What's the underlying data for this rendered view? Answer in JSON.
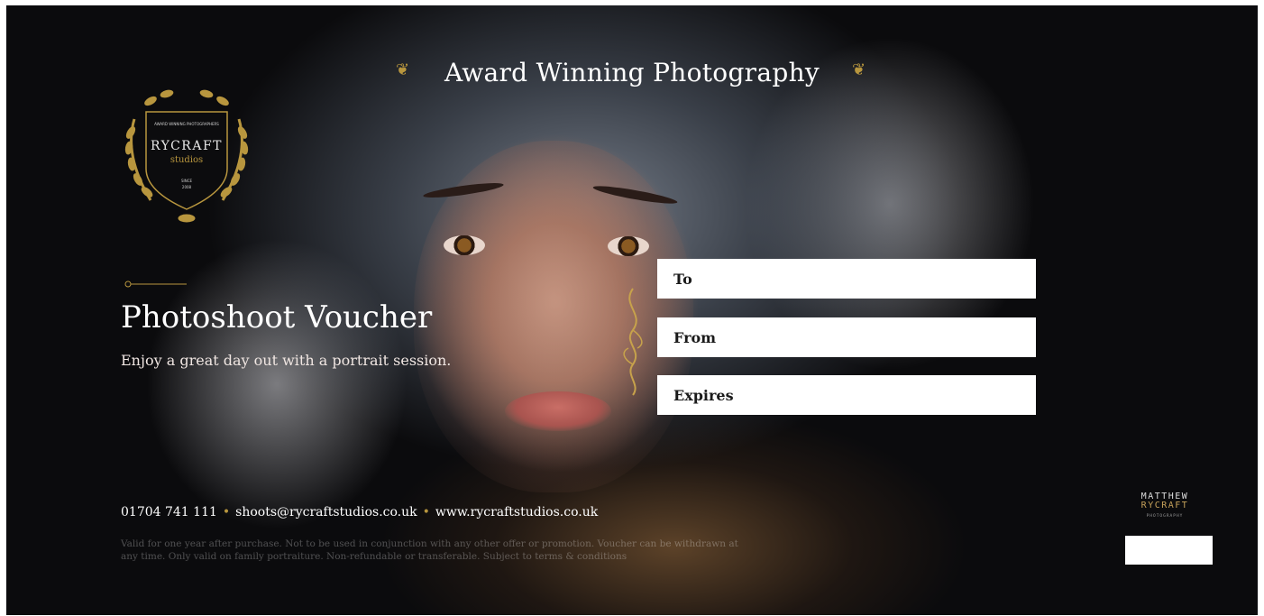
{
  "header": {
    "title": "Award Winning Photography"
  },
  "logo": {
    "top_text": "AWARD WINNING PHOTOGRAPHERS",
    "name": "RYCRAFT",
    "sub": "studios",
    "since": "SINCE",
    "year": "2008"
  },
  "voucher": {
    "heading": "Photoshoot Voucher",
    "subheading": "Enjoy a great day out with a portrait session."
  },
  "fields": [
    {
      "label": "To"
    },
    {
      "label": "From"
    },
    {
      "label": "Expires"
    }
  ],
  "contact": {
    "phone": "01704 741 111",
    "email": "shoots@rycraftstudios.co.uk",
    "website": "www.rycraftstudios.co.uk",
    "separator": "•"
  },
  "terms": "Valid for one year after purchase. Not to be used in conjunction with any other offer or promotion. Voucher can be withdrawn at any time. Only valid on family portraiture. Non-refundable or transferable. Subject to terms & conditions",
  "brand": {
    "line1": "MATTHEW",
    "line2": "RYCRAFT",
    "line3": "PHOTOGRAPHY"
  },
  "colors": {
    "gold": "#b8963e",
    "background": "#0b0b0d",
    "field_bg": "#ffffff"
  }
}
